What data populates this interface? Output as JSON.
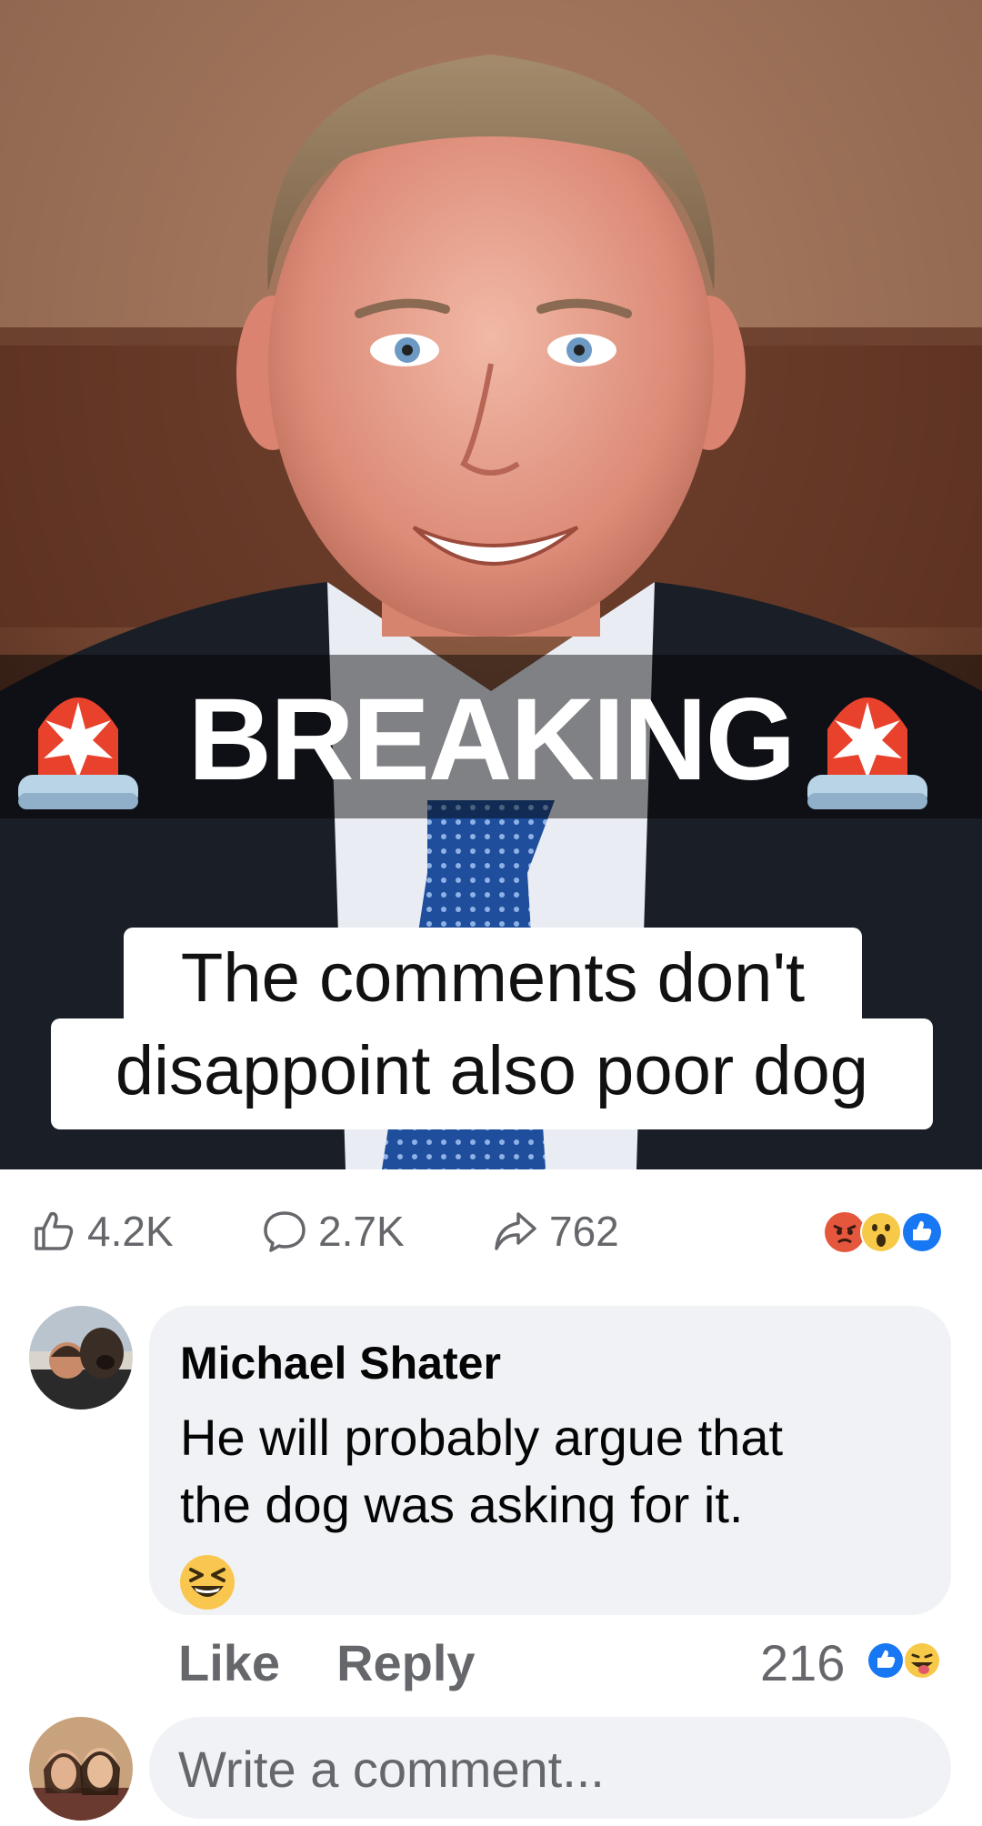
{
  "post": {
    "overlay_title": "BREAKING",
    "caption_line1": "The comments don't",
    "caption_line2": "disappoint also poor dog"
  },
  "stats": {
    "likes": "4.2K",
    "comments": "2.7K",
    "shares": "762",
    "reactions": [
      "angry-face-icon",
      "wow-face-icon",
      "like-thumb-icon"
    ]
  },
  "comment": {
    "author": "Michael Shater",
    "line1": "He will probably argue that",
    "line2": "the dog was asking for it.",
    "emoji": "laughing-squint-emoji",
    "like_label": "Like",
    "reply_label": "Reply",
    "reaction_count": "216",
    "reactions": [
      "like-thumb-icon",
      "tongue-out-face-icon"
    ]
  },
  "composer": {
    "placeholder": "Write a comment..."
  },
  "colors": {
    "secondary_text": "#65676b",
    "bubble_bg": "#f0f2f5",
    "facebook_blue": "#1877f2"
  }
}
